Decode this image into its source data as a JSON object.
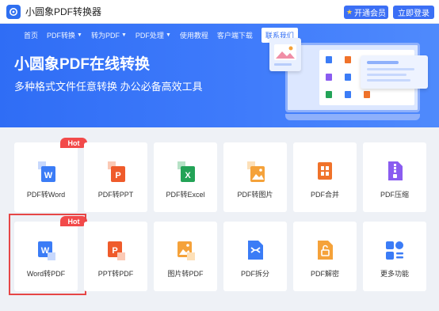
{
  "app": {
    "title": "小圆象PDF转换器",
    "vip_label": "开通会员",
    "login_label": "立即登录"
  },
  "nav": [
    {
      "label": "首页",
      "dropdown": false,
      "active": false
    },
    {
      "label": "PDF转换",
      "dropdown": true,
      "active": false
    },
    {
      "label": "转为PDF",
      "dropdown": true,
      "active": false
    },
    {
      "label": "PDF处理",
      "dropdown": true,
      "active": false
    },
    {
      "label": "使用教程",
      "dropdown": false,
      "active": false
    },
    {
      "label": "客户端下载",
      "dropdown": false,
      "active": false
    },
    {
      "label": "联系我们",
      "dropdown": false,
      "active": true
    }
  ],
  "hero": {
    "title": "小圆象PDF在线转换",
    "subtitle": "多种格式文件任意转换 办公必备高效工具"
  },
  "hot_badge": "Hot",
  "tools_row1": [
    {
      "label": "PDF转Word",
      "icon": "pdf-to-word-icon",
      "color": "#3b7cf6",
      "hot": true
    },
    {
      "label": "PDF转PPT",
      "icon": "pdf-to-ppt-icon",
      "color": "#ef5b2b",
      "hot": false
    },
    {
      "label": "PDF转Excel",
      "icon": "pdf-to-excel-icon",
      "color": "#23a357",
      "hot": false
    },
    {
      "label": "PDF转图片",
      "icon": "pdf-to-image-icon",
      "color": "#f5a23a",
      "hot": false
    },
    {
      "label": "PDF合并",
      "icon": "pdf-merge-icon",
      "color": "#f0722a",
      "hot": false
    },
    {
      "label": "PDF压缩",
      "icon": "pdf-compress-icon",
      "color": "#8a5cf0",
      "hot": false
    }
  ],
  "tools_row2": [
    {
      "label": "Word转PDF",
      "icon": "word-to-pdf-icon",
      "color": "#3b7cf6",
      "hot": true
    },
    {
      "label": "PPT转PDF",
      "icon": "ppt-to-pdf-icon",
      "color": "#ef5b2b",
      "hot": false
    },
    {
      "label": "图片转PDF",
      "icon": "image-to-pdf-icon",
      "color": "#f5a23a",
      "hot": false
    },
    {
      "label": "PDF拆分",
      "icon": "pdf-split-icon",
      "color": "#3b7cf6",
      "hot": false
    },
    {
      "label": "PDF解密",
      "icon": "pdf-decrypt-icon",
      "color": "#f5a23a",
      "hot": false
    },
    {
      "label": "更多功能",
      "icon": "more-features-icon",
      "color": "#3b7cf6",
      "hot": false
    }
  ]
}
